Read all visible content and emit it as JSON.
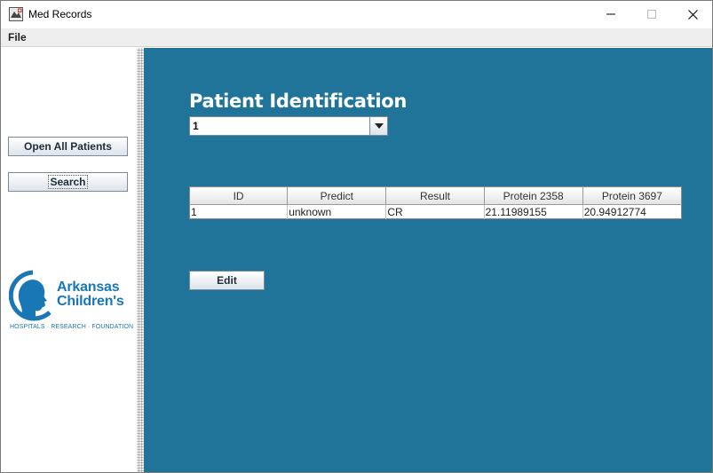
{
  "window": {
    "title": "Med Records",
    "icon": "med-records-app-icon"
  },
  "menu": {
    "file_label": "File"
  },
  "sidebar": {
    "open_all_label": "Open All Patients",
    "search_label": "Search",
    "logo": {
      "line1": "Arkansas",
      "line2": "Children's",
      "tagline": "HOSPITALS · RESEARCH · FOUNDATION",
      "color": "#1a77b6"
    }
  },
  "main": {
    "heading": "Patient Identification",
    "patient_select_value": "1",
    "background_color": "#217499",
    "table": {
      "columns": [
        "ID",
        "Predict",
        "Result",
        "Protein 2358",
        "Protein 3697"
      ],
      "rows": [
        [
          "1",
          "unknown",
          "CR",
          "21.11989155",
          "20.94912774"
        ]
      ]
    },
    "edit_label": "Edit"
  }
}
